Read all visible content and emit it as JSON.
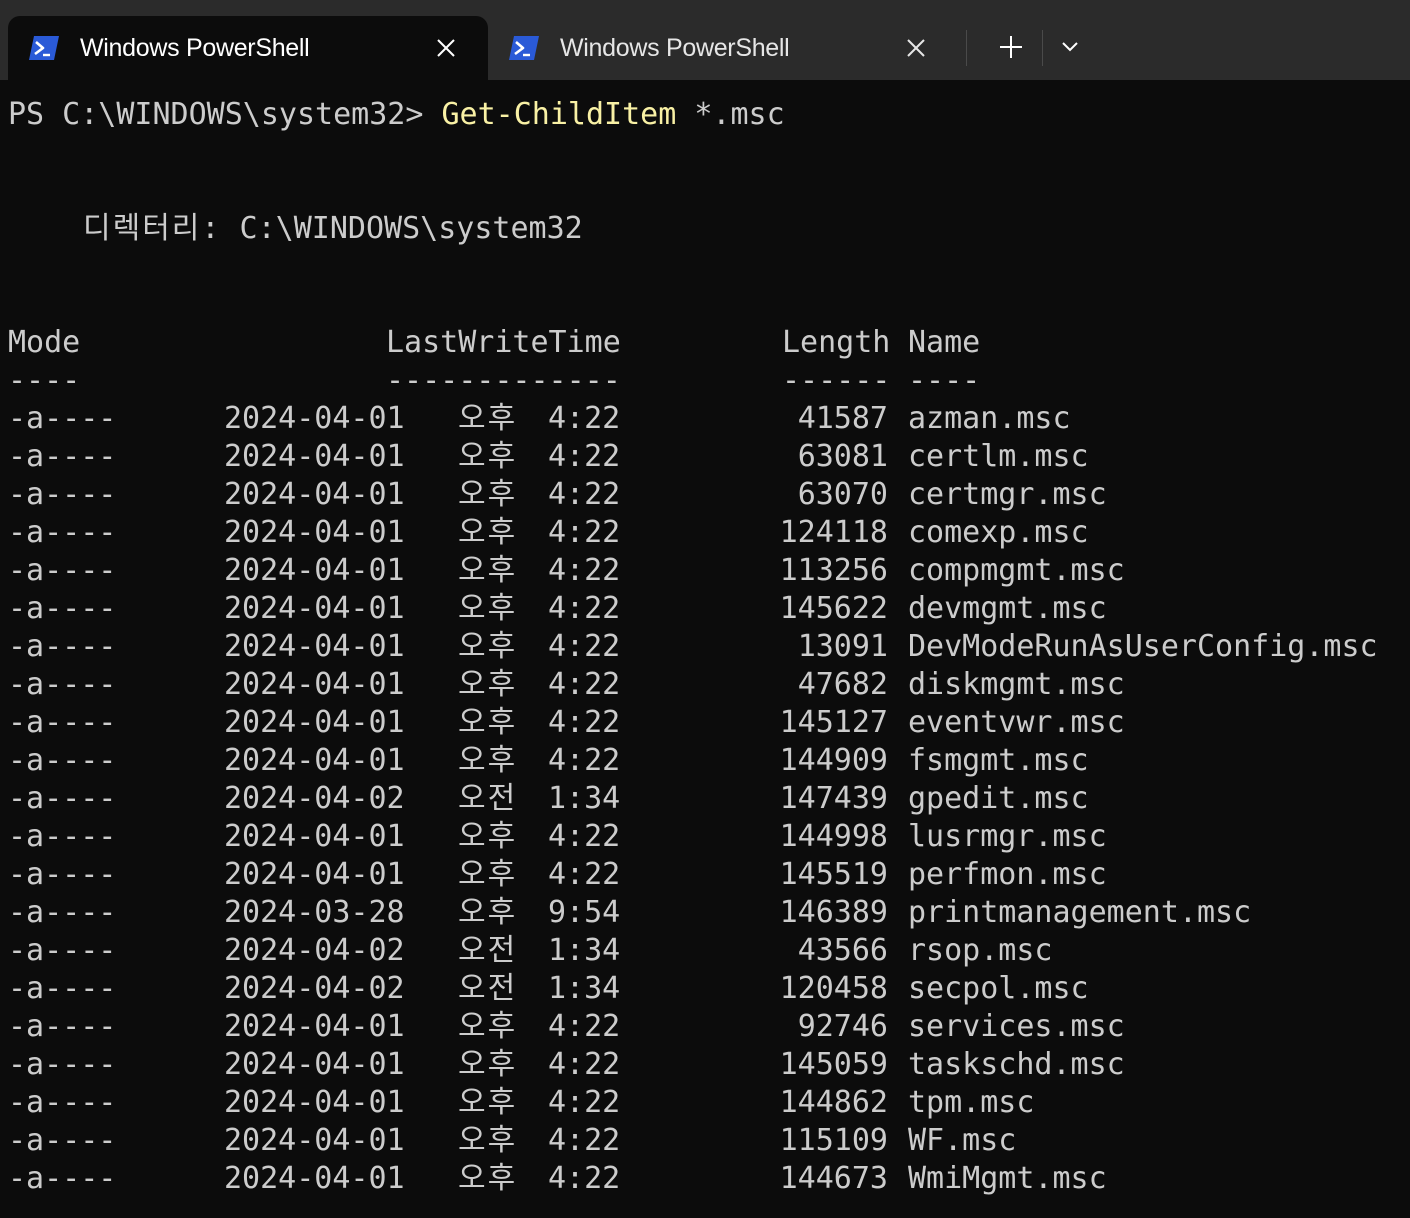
{
  "window": {
    "tabs": [
      {
        "title": "Windows PowerShell",
        "active": true,
        "icon": "powershell-icon"
      },
      {
        "title": "Windows PowerShell",
        "active": false,
        "icon": "powershell-icon"
      }
    ],
    "new_tab_icon": "plus-icon",
    "dropdown_icon": "chevron-down-icon"
  },
  "colors": {
    "background": "#0c0c0c",
    "tabbar": "#2b2b2b",
    "text": "#cccccc",
    "command": "#f9f1a5",
    "icon_blue": "#2a5ad7"
  },
  "terminal": {
    "prompt": "PS C:\\WINDOWS\\system32> ",
    "command": "Get-ChildItem",
    "argument": " *.msc",
    "directory_label": "디렉터리:",
    "directory_path": "C:\\WINDOWS\\system32",
    "headers": {
      "mode": "Mode",
      "lastwritetime": "LastWriteTime",
      "length": "Length",
      "name": "Name"
    },
    "separators": {
      "mode": "----",
      "lastwritetime": "-------------",
      "length": "------",
      "name": "----"
    },
    "files": [
      {
        "mode": "-a----",
        "date": "2024-04-01",
        "ampm": "오후",
        "time": "4:22",
        "length": "41587",
        "name": "azman.msc"
      },
      {
        "mode": "-a----",
        "date": "2024-04-01",
        "ampm": "오후",
        "time": "4:22",
        "length": "63081",
        "name": "certlm.msc"
      },
      {
        "mode": "-a----",
        "date": "2024-04-01",
        "ampm": "오후",
        "time": "4:22",
        "length": "63070",
        "name": "certmgr.msc"
      },
      {
        "mode": "-a----",
        "date": "2024-04-01",
        "ampm": "오후",
        "time": "4:22",
        "length": "124118",
        "name": "comexp.msc"
      },
      {
        "mode": "-a----",
        "date": "2024-04-01",
        "ampm": "오후",
        "time": "4:22",
        "length": "113256",
        "name": "compmgmt.msc"
      },
      {
        "mode": "-a----",
        "date": "2024-04-01",
        "ampm": "오후",
        "time": "4:22",
        "length": "145622",
        "name": "devmgmt.msc"
      },
      {
        "mode": "-a----",
        "date": "2024-04-01",
        "ampm": "오후",
        "time": "4:22",
        "length": "13091",
        "name": "DevModeRunAsUserConfig.msc"
      },
      {
        "mode": "-a----",
        "date": "2024-04-01",
        "ampm": "오후",
        "time": "4:22",
        "length": "47682",
        "name": "diskmgmt.msc"
      },
      {
        "mode": "-a----",
        "date": "2024-04-01",
        "ampm": "오후",
        "time": "4:22",
        "length": "145127",
        "name": "eventvwr.msc"
      },
      {
        "mode": "-a----",
        "date": "2024-04-01",
        "ampm": "오후",
        "time": "4:22",
        "length": "144909",
        "name": "fsmgmt.msc"
      },
      {
        "mode": "-a----",
        "date": "2024-04-02",
        "ampm": "오전",
        "time": "1:34",
        "length": "147439",
        "name": "gpedit.msc"
      },
      {
        "mode": "-a----",
        "date": "2024-04-01",
        "ampm": "오후",
        "time": "4:22",
        "length": "144998",
        "name": "lusrmgr.msc"
      },
      {
        "mode": "-a----",
        "date": "2024-04-01",
        "ampm": "오후",
        "time": "4:22",
        "length": "145519",
        "name": "perfmon.msc"
      },
      {
        "mode": "-a----",
        "date": "2024-03-28",
        "ampm": "오후",
        "time": "9:54",
        "length": "146389",
        "name": "printmanagement.msc"
      },
      {
        "mode": "-a----",
        "date": "2024-04-02",
        "ampm": "오전",
        "time": "1:34",
        "length": "43566",
        "name": "rsop.msc"
      },
      {
        "mode": "-a----",
        "date": "2024-04-02",
        "ampm": "오전",
        "time": "1:34",
        "length": "120458",
        "name": "secpol.msc"
      },
      {
        "mode": "-a----",
        "date": "2024-04-01",
        "ampm": "오후",
        "time": "4:22",
        "length": "92746",
        "name": "services.msc"
      },
      {
        "mode": "-a----",
        "date": "2024-04-01",
        "ampm": "오후",
        "time": "4:22",
        "length": "145059",
        "name": "taskschd.msc"
      },
      {
        "mode": "-a----",
        "date": "2024-04-01",
        "ampm": "오후",
        "time": "4:22",
        "length": "144862",
        "name": "tpm.msc"
      },
      {
        "mode": "-a----",
        "date": "2024-04-01",
        "ampm": "오후",
        "time": "4:22",
        "length": "115109",
        "name": "WF.msc"
      },
      {
        "mode": "-a----",
        "date": "2024-04-01",
        "ampm": "오후",
        "time": "4:22",
        "length": "144673",
        "name": "WmiMgmt.msc"
      }
    ]
  }
}
